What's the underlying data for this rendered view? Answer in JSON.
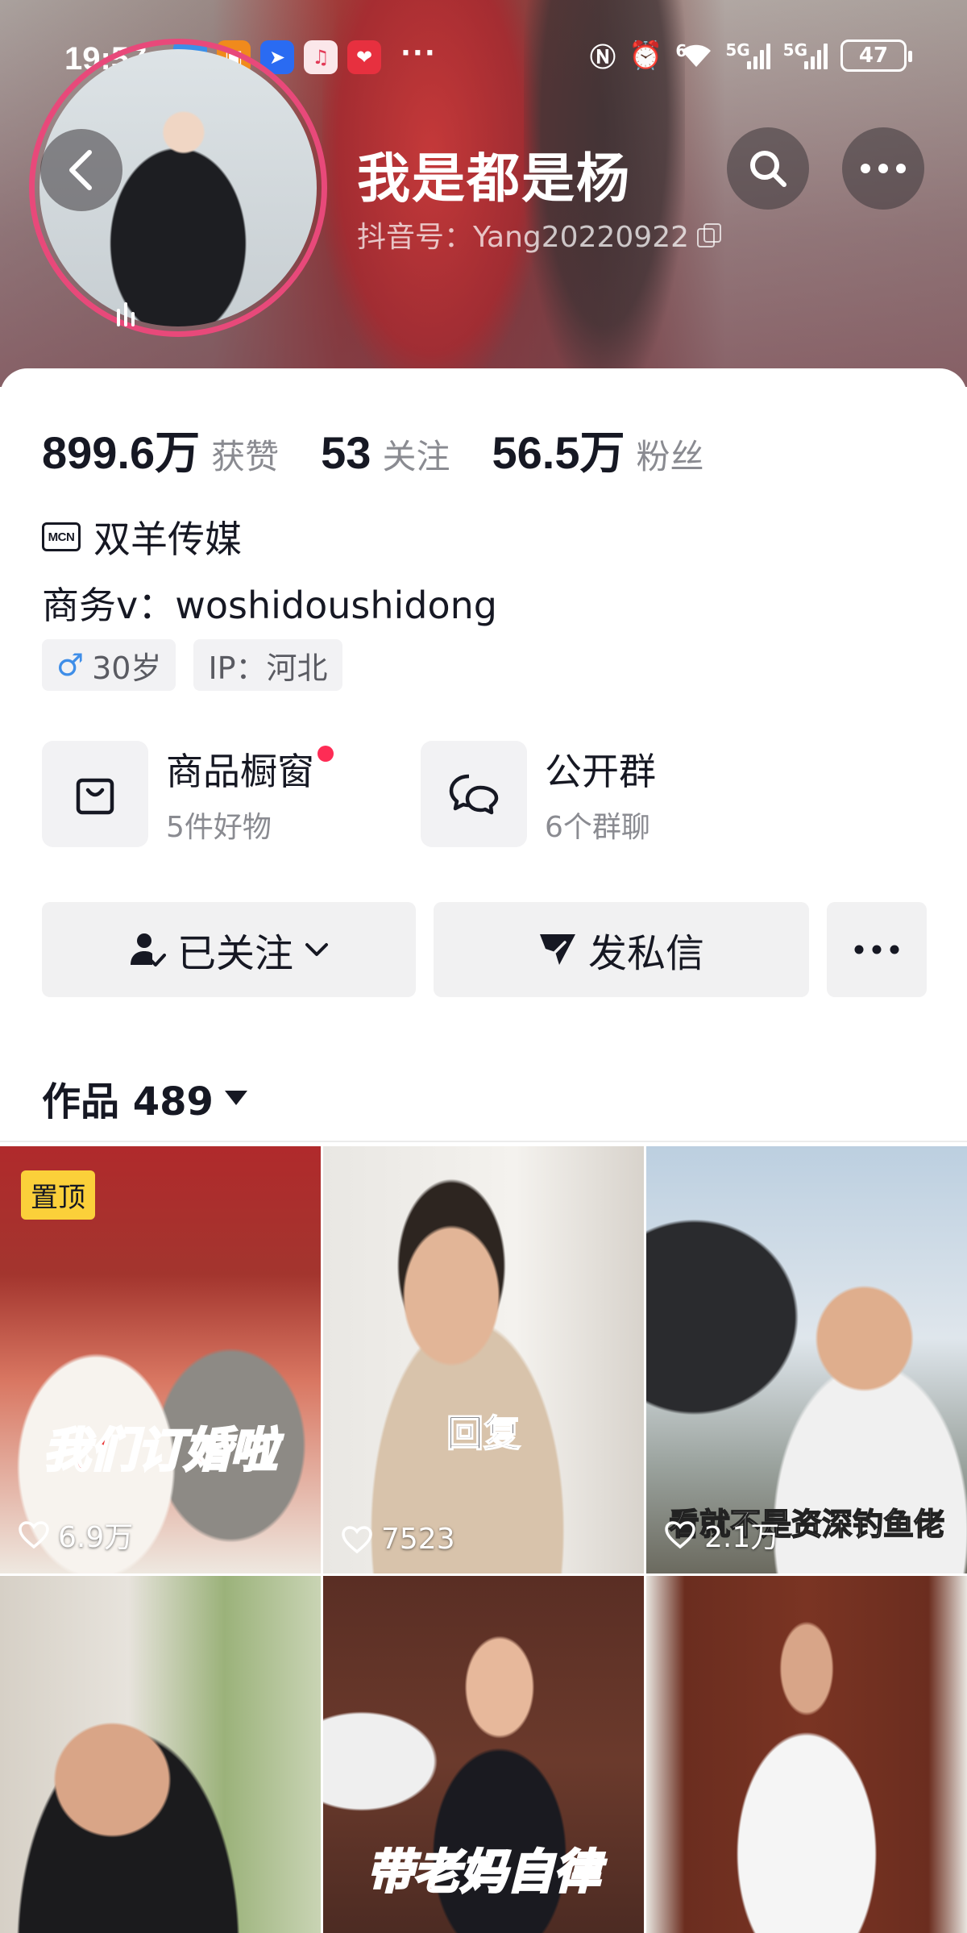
{
  "status_bar": {
    "time": "19:57",
    "dots": "···",
    "battery": "47",
    "network_1": "6",
    "network_2": "5G",
    "network_3": "5G"
  },
  "profile": {
    "nickname": "我是都是杨",
    "douyin_id": "抖音号：Yang20220922",
    "ring_color": "#e8497a"
  },
  "stats": [
    {
      "value": "899.6万",
      "label": "获赞"
    },
    {
      "value": "53",
      "label": "关注"
    },
    {
      "value": "56.5万",
      "label": "粉丝"
    }
  ],
  "mcn": {
    "badge": "MCN",
    "name": "双羊传媒"
  },
  "bio": "商务v：woshidoushidong",
  "tags": {
    "age": "30岁",
    "ip": "IP：河北"
  },
  "features": [
    {
      "title": "商品橱窗",
      "subtitle": "5件好物",
      "icon": "shopping-bag-icon"
    },
    {
      "title": "公开群",
      "subtitle": "6个群聊",
      "icon": "group-chat-icon"
    }
  ],
  "actions": {
    "follow": "已关注",
    "message": "发私信",
    "more": "···"
  },
  "works": {
    "title": "作品 489"
  },
  "videos": [
    {
      "pinned": "置顶",
      "caption": "我们订婚啦",
      "likes": "6.9万"
    },
    {
      "pinned": "",
      "caption": "回复",
      "likes": "7523"
    },
    {
      "pinned": "",
      "caption": "看就不是资深钓鱼佬",
      "likes": "2.1万"
    },
    {
      "pinned": "",
      "caption": "",
      "likes": ""
    },
    {
      "pinned": "",
      "caption": "带老妈自律",
      "likes": ""
    },
    {
      "pinned": "",
      "caption": "",
      "likes": ""
    }
  ],
  "colors": {
    "accent_red": "#fe2c55",
    "pin_yellow": "#fbd03a",
    "male_blue": "#3f8ee8"
  }
}
